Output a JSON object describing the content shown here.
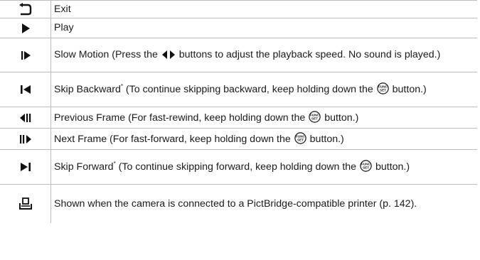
{
  "rows": [
    {
      "icon": "exit-return-arrow-icon",
      "text": "Exit"
    },
    {
      "icon": "play-triangle-icon",
      "text": "Play"
    },
    {
      "icon": "slow-motion-icon",
      "text_a": "Slow Motion (Press the",
      "arrows_icon": "left-right-arrows-icon",
      "text_b": "buttons to adjust the playback speed. No sound is played.)"
    },
    {
      "icon": "skip-backward-icon",
      "text_a": "Skip Backward",
      "asterisk": "*",
      "text_b": "(To continue skipping backward, keep holding down the",
      "button_icon": "func-set-button-icon",
      "text_c": "button.)"
    },
    {
      "icon": "previous-frame-icon",
      "text_a": "Previous Frame (For fast-rewind, keep holding down the",
      "button_icon": "func-set-button-icon",
      "text_c": "button.)"
    },
    {
      "icon": "next-frame-icon",
      "text_a": "Next Frame (For fast-forward, keep holding down the",
      "button_icon": "func-set-button-icon",
      "text_c": "button.)"
    },
    {
      "icon": "skip-forward-icon",
      "text_a": "Skip Forward",
      "asterisk": "*",
      "text_b": "(To continue skipping forward, keep holding down the",
      "button_icon": "func-set-button-icon",
      "text_c": "button.)"
    },
    {
      "icon": "print-icon",
      "text": "Shown when the camera is connected to a PictBridge-compatible printer (p. 142)."
    }
  ],
  "func_button_label_top": "FUNC",
  "func_button_label_bottom": "SET"
}
